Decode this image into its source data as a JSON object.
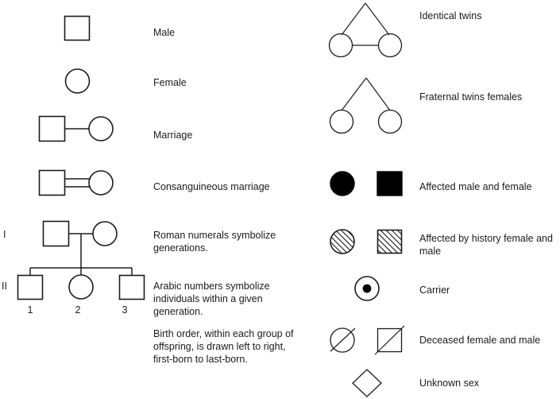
{
  "page": {
    "title": "Pedigree chart symbol legend",
    "background": "#ffffff",
    "ink": "#1c1c1c"
  },
  "left_column": {
    "entries": [
      {
        "key": "male",
        "label": "Male",
        "symbol": "open-square"
      },
      {
        "key": "female",
        "label": "Female",
        "symbol": "open-circle"
      },
      {
        "key": "marriage",
        "label": "Marriage",
        "symbol": "square-line-circle"
      },
      {
        "key": "consanguineous_marriage",
        "label": "Consanguineous marriage",
        "symbol": "square-double-line-circle"
      },
      {
        "key": "roman_numerals",
        "label": "Roman numerals symbolize generations.",
        "symbol": "pedigree-generation-I"
      },
      {
        "key": "arabic_numbers",
        "label": "Arabic numbers symbolize individuals within a given generation.",
        "symbol": "pedigree-generation-II"
      },
      {
        "key": "birth_order",
        "label": "Birth order, within each group of offspring, is drawn left to right, first-born to last-born.",
        "symbol": "none"
      }
    ],
    "pedigree": {
      "generation_labels": [
        "I",
        "II"
      ],
      "individual_numbers": [
        "1",
        "2",
        "3"
      ],
      "parents": [
        "male",
        "female"
      ],
      "children": [
        "male",
        "female",
        "male"
      ]
    }
  },
  "right_column": {
    "entries": [
      {
        "key": "identical_twins",
        "label": "Identical twins",
        "symbol": "twin-circles-joined"
      },
      {
        "key": "fraternal_twins",
        "label": "Fraternal twins females",
        "symbol": "twin-circles-separate"
      },
      {
        "key": "affected",
        "label": "Affected male and female",
        "symbol": "filled-circle-and-filled-square"
      },
      {
        "key": "affected_by_history",
        "label": "Affected by history female and male",
        "symbol": "hatched-circle-and-hatched-square"
      },
      {
        "key": "carrier",
        "label": "Carrier",
        "symbol": "circle-with-dot"
      },
      {
        "key": "deceased",
        "label": "Deceased female and male",
        "symbol": "slashed-circle-and-slashed-square"
      },
      {
        "key": "unknown_sex",
        "label": "Unknown sex",
        "symbol": "open-diamond"
      }
    ]
  }
}
